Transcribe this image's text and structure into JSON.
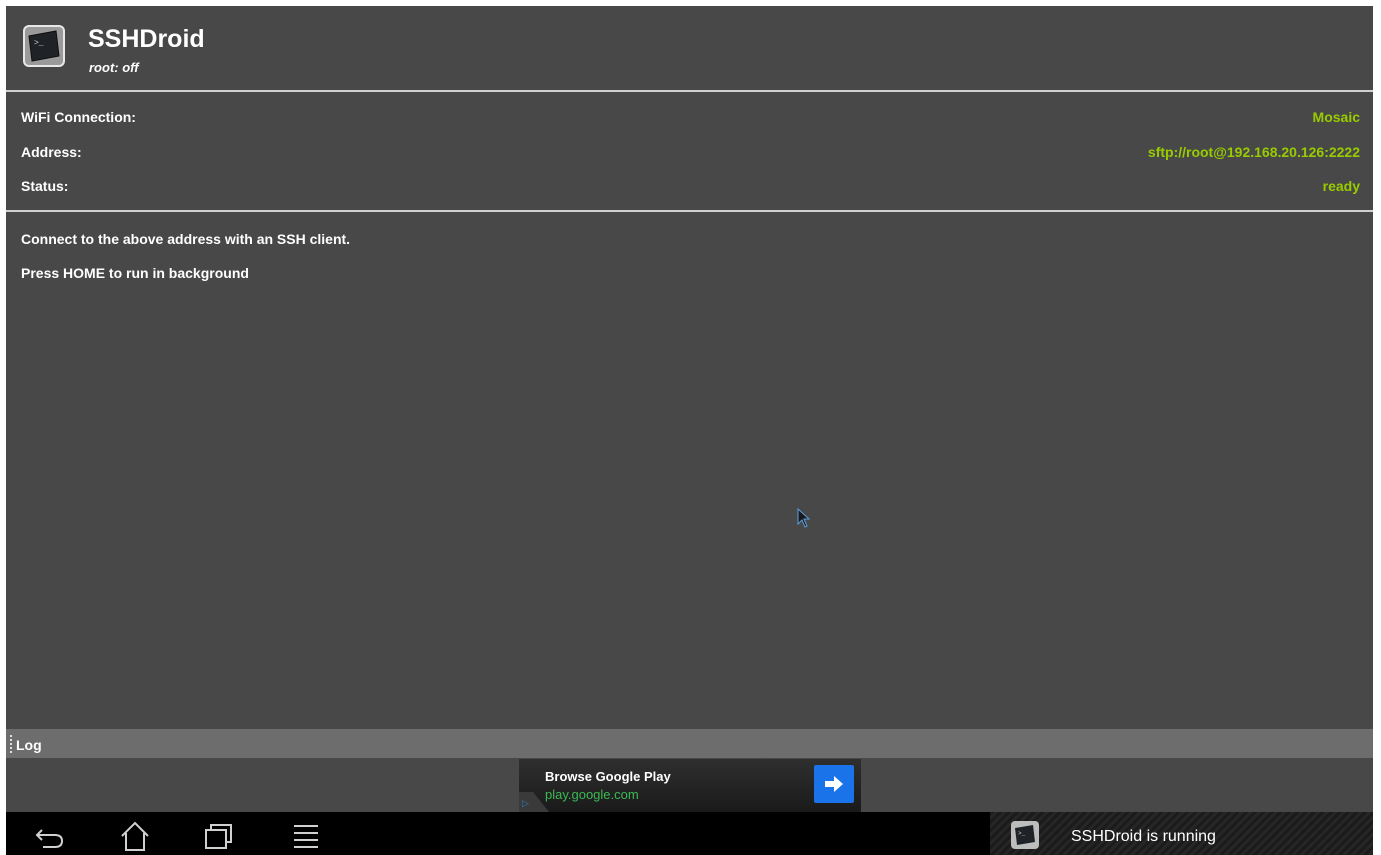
{
  "app": {
    "title": "SSHDroid",
    "subtitle": "root: off",
    "icon": "terminal-icon"
  },
  "info": {
    "wifi_label": "WiFi Connection:",
    "wifi_value": "Mosaic",
    "address_label": "Address:",
    "address_value": "sftp://root@192.168.20.126:2222",
    "status_label": "Status:",
    "status_value": "ready"
  },
  "messages": {
    "connect": "Connect to the above address with an SSH client.",
    "home": "Press HOME to run in background"
  },
  "log": {
    "label": "Log"
  },
  "ad": {
    "title": "Browse Google Play",
    "url": "play.google.com",
    "arrow_icon": "arrow-right-icon"
  },
  "navbar": {
    "buttons": [
      "back-icon",
      "home-icon",
      "recent-apps-icon",
      "menu-icon"
    ],
    "notification_text": "SSHDroid is running"
  },
  "colors": {
    "background": "#484848",
    "accent_value": "#99cc00",
    "log_bar": "#6d6d6d",
    "ad_button": "#1a73e8"
  }
}
